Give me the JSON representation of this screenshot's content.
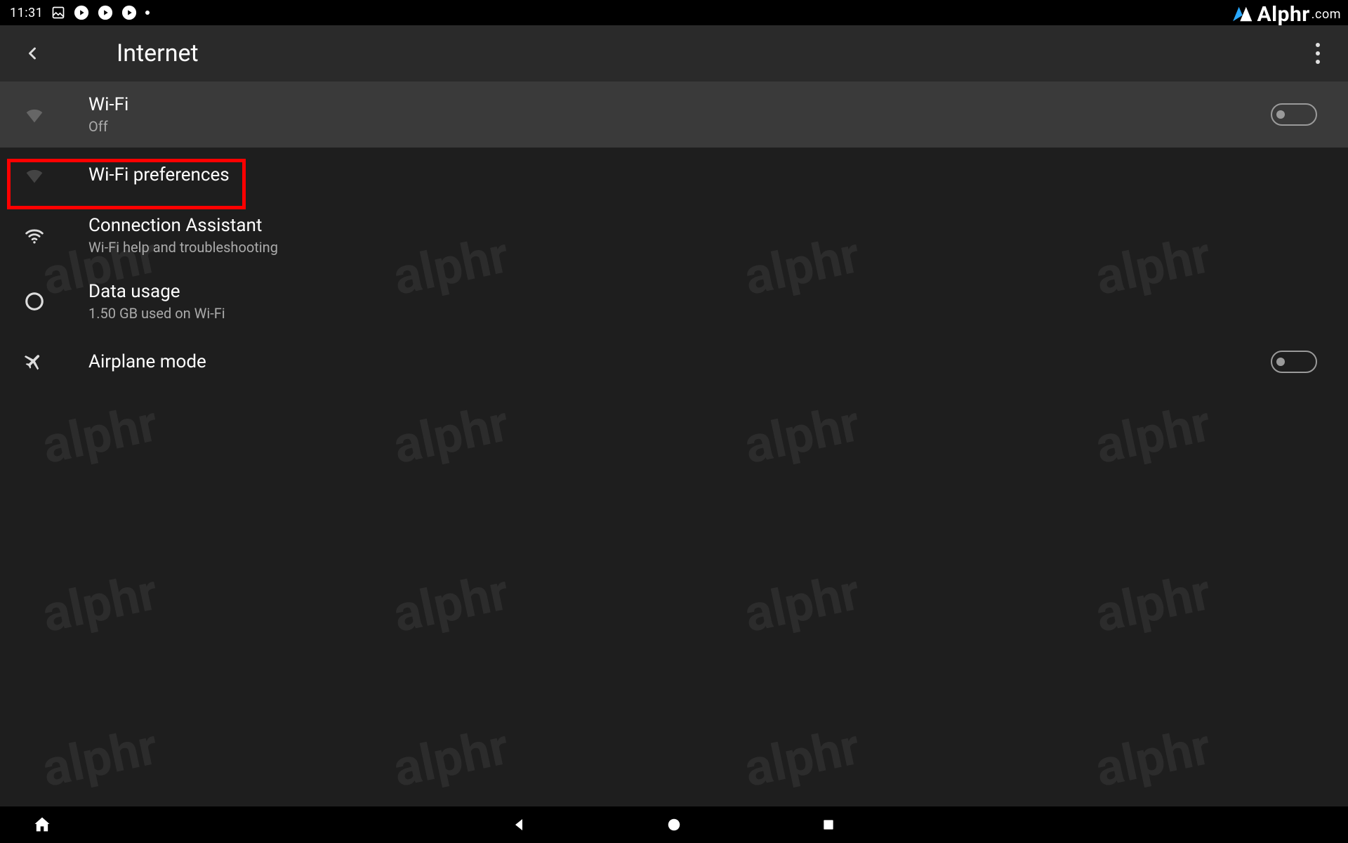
{
  "statusbar": {
    "time": "11:31"
  },
  "brand": {
    "name": "Alphr",
    "suffix": ".com"
  },
  "header": {
    "title": "Internet"
  },
  "rows": {
    "wifi": {
      "label": "Wi-Fi",
      "sub": "Off",
      "toggle": "off"
    },
    "wifi_prefs": {
      "label": "Wi-Fi preferences"
    },
    "conn_assist": {
      "label": "Connection Assistant",
      "sub": "Wi-Fi help and troubleshooting"
    },
    "data_usage": {
      "label": "Data usage",
      "sub": "1.50 GB used on Wi-Fi"
    },
    "airplane": {
      "label": "Airplane mode",
      "toggle": "off"
    }
  },
  "watermark_text": "alphr"
}
